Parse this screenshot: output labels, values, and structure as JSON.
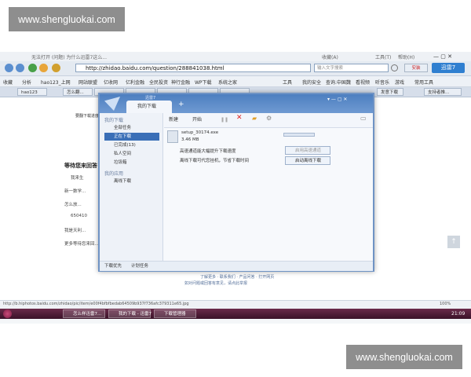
{
  "watermark": {
    "top": "www.shengluokai.com",
    "bottom": "www.shengluokai.com"
  },
  "browser": {
    "title_bar": "无法打开 (问题) 为什么迅雷7这么...",
    "menu": [
      "收藏(A)",
      "工具(T)",
      "帮助(H)"
    ],
    "url": "http://zhidao.baidu.com/question/288841038.html",
    "search_placeholder": "输入文字搜索",
    "right_buttons": [
      "迅雷7",
      "安装"
    ],
    "toolbar_items": [
      "收藏",
      "分析",
      "hao123_上网",
      "网站联盟",
      "亿收网",
      "亿利金融",
      "全民投资",
      "神行金融",
      "WP下载",
      "系统之家"
    ],
    "toolbar_right": [
      "工具",
      "我的安全",
      "查询.中国魏",
      "看视频",
      "听音乐",
      "游戏",
      "常用工具"
    ],
    "tabs": [
      "hao123",
      "怎么翻...",
      "",
      "",
      "",
      "",
      "",
      ""
    ],
    "tabs_right": [
      "发意下载",
      "支持者推..."
    ],
    "status_url": "http://b.hiphotos.baidu.com/zhidao/pic/item/e00f4bfbfbedab64509b937f736afc379311e65.jpg",
    "zoom": "100%"
  },
  "page": {
    "left_texts": [
      "等待您来回答",
      "我来生",
      "新一数学...",
      "怎么放...",
      "650410",
      "我是天利...",
      "更多等待您来回..."
    ],
    "question_label": "要翻下载进度",
    "footer_links": [
      "了解更多 · 联系我们 · 产品问答 · 打开网页"
    ],
    "footer_links2": [
      "如对问题或回答有意见，请点此举报"
    ]
  },
  "thunder": {
    "app_name": "迅雷7",
    "tab_label": "我的下载",
    "add_tab": "+",
    "sidebar": {
      "section1": "我的下载",
      "items": [
        "全部任务",
        "正在下载",
        "已完成(13)",
        "私人空间",
        "垃圾箱"
      ],
      "section2": "我的应用",
      "apps": [
        "离线下载"
      ]
    },
    "toolbar": [
      "新建",
      "开始"
    ],
    "task": {
      "filename": "setup_30174.exe",
      "size": "3.46 MB",
      "progress": 0.0,
      "percent": "0%"
    },
    "hints": [
      "高速通道能大幅提升下载速度",
      "离线下载可代您挂机，节省下载时间"
    ],
    "buttons": [
      "启用高速通道",
      "启动离线下载"
    ],
    "footer": [
      "下载优先",
      "计划任务"
    ]
  },
  "taskbar": {
    "tasks": [
      "怎么样迅雷7...",
      "我的下载 - 迅雷7",
      "下载管理器"
    ],
    "time": "21:09"
  }
}
